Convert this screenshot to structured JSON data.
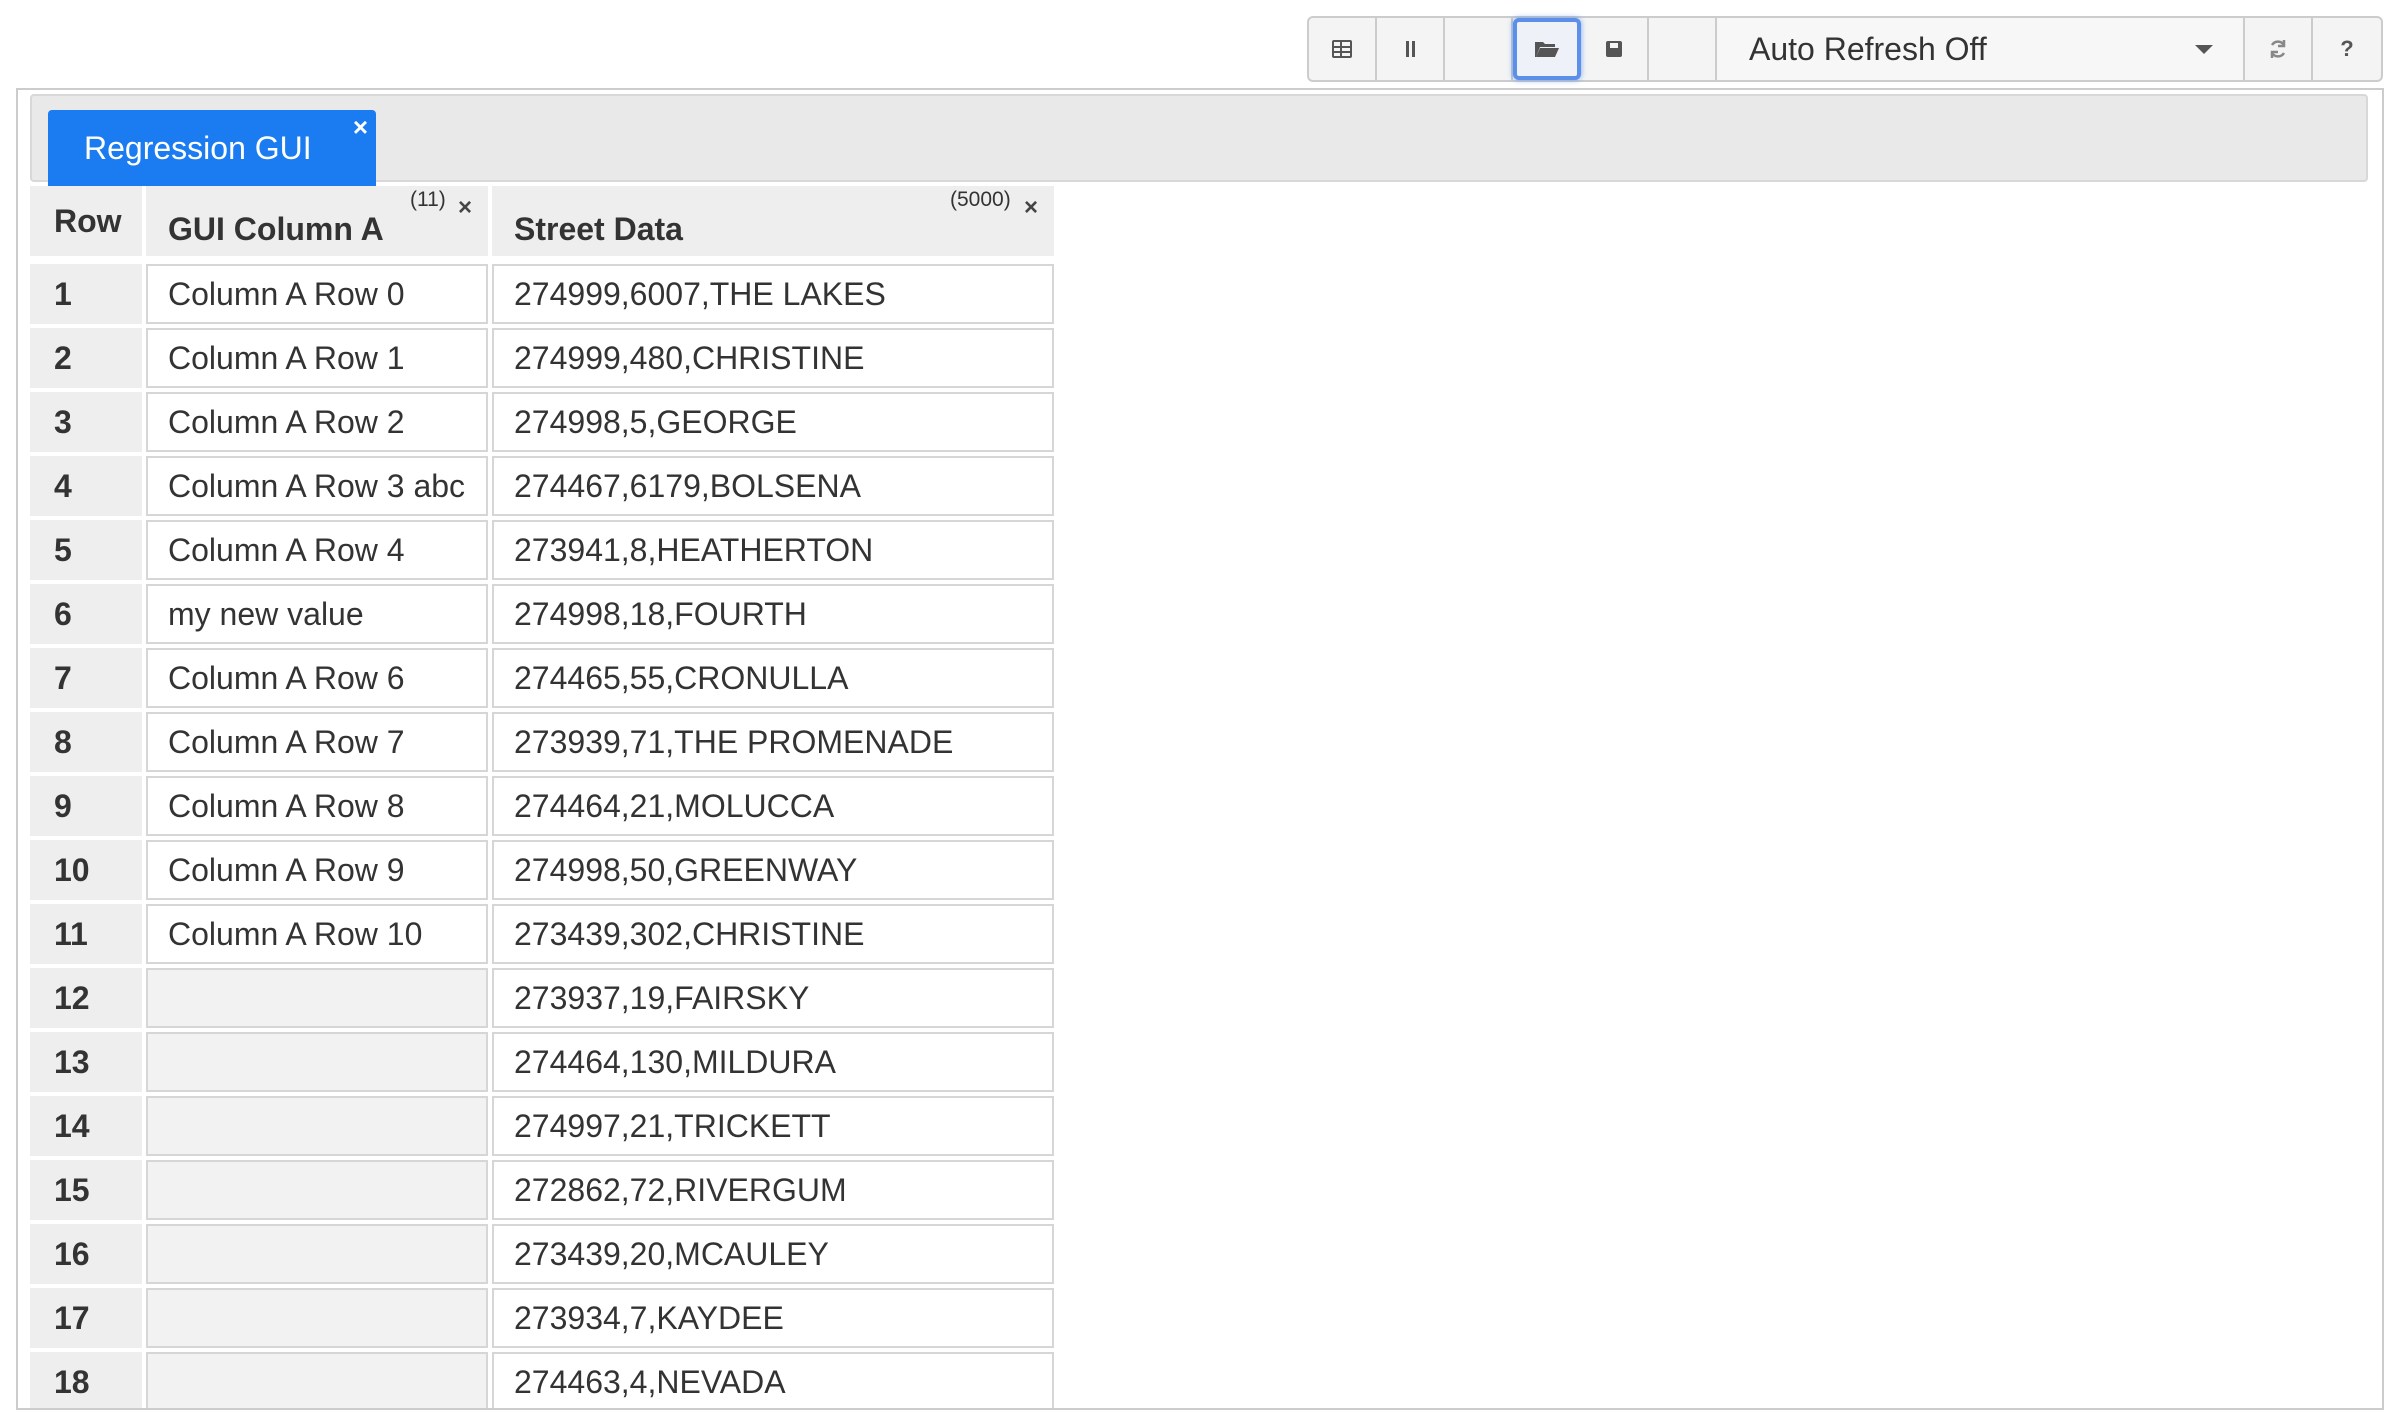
{
  "toolbar": {
    "buttons": [
      {
        "name": "table-view",
        "icon": "grid-icon"
      },
      {
        "name": "columns",
        "icon": "columns-icon"
      },
      {
        "name": "blank-1",
        "icon": ""
      },
      {
        "name": "open",
        "icon": "folder-open-icon"
      },
      {
        "name": "save",
        "icon": "save-icon"
      },
      {
        "name": "blank-2",
        "icon": ""
      }
    ],
    "refresh_select": "Auto Refresh Off",
    "refresh_button_icon": "refresh-icon",
    "help_label": "?"
  },
  "tab": {
    "label": "Regression GUI",
    "close": "×",
    "color": "#1a7cf0"
  },
  "grid": {
    "headers": {
      "row": "Row",
      "col_a": "GUI Column A",
      "col_a_count": "(11)",
      "col_b": "Street Data",
      "col_b_count": "(5000)",
      "close": "×"
    },
    "rows": [
      {
        "n": "1",
        "a": "Column A Row 0",
        "s": "274999,6007,THE LAKES"
      },
      {
        "n": "2",
        "a": "Column A Row 1",
        "s": "274999,480,CHRISTINE"
      },
      {
        "n": "3",
        "a": "Column A Row 2",
        "s": "274998,5,GEORGE"
      },
      {
        "n": "4",
        "a": "Column A Row 3 abc",
        "s": "274467,6179,BOLSENA"
      },
      {
        "n": "5",
        "a": "Column A Row 4",
        "s": "273941,8,HEATHERTON"
      },
      {
        "n": "6",
        "a": "my new value",
        "s": "274998,18,FOURTH"
      },
      {
        "n": "7",
        "a": "Column A Row 6",
        "s": "274465,55,CRONULLA"
      },
      {
        "n": "8",
        "a": "Column A Row 7",
        "s": "273939,71,THE PROMENADE"
      },
      {
        "n": "9",
        "a": "Column A Row 8",
        "s": "274464,21,MOLUCCA"
      },
      {
        "n": "10",
        "a": "Column A Row 9",
        "s": "274998,50,GREENWAY"
      },
      {
        "n": "11",
        "a": "Column A Row 10",
        "s": "273439,302,CHRISTINE"
      },
      {
        "n": "12",
        "a": "",
        "s": "273937,19,FAIRSKY"
      },
      {
        "n": "13",
        "a": "",
        "s": "274464,130,MILDURA"
      },
      {
        "n": "14",
        "a": "",
        "s": "274997,21,TRICKETT"
      },
      {
        "n": "15",
        "a": "",
        "s": "272862,72,RIVERGUM"
      },
      {
        "n": "16",
        "a": "",
        "s": "273439,20,MCAULEY"
      },
      {
        "n": "17",
        "a": "",
        "s": "273934,7,KAYDEE"
      },
      {
        "n": "18",
        "a": "",
        "s": "274463,4,NEVADA"
      }
    ]
  }
}
